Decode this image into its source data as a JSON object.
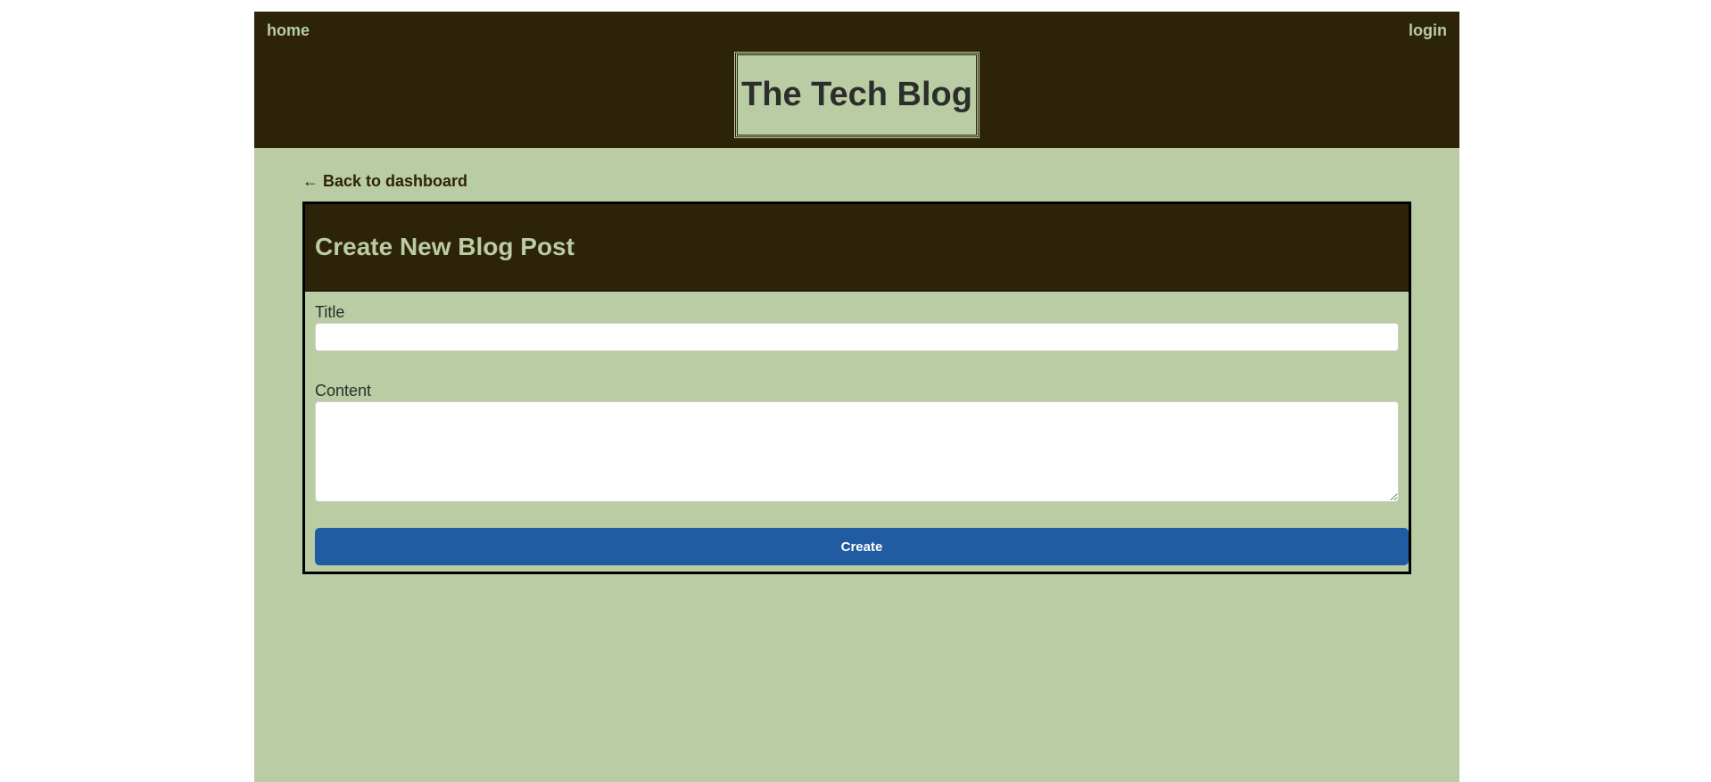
{
  "nav": {
    "home_label": "home",
    "login_label": "login"
  },
  "header": {
    "site_title": "The Tech Blog"
  },
  "main": {
    "back_link": "← Back to dashboard",
    "form": {
      "heading": "Create New Blog Post",
      "title_label": "Title",
      "title_value": "",
      "content_label": "Content",
      "content_value": "",
      "submit_label": "Create"
    }
  },
  "colors": {
    "header_bg": "#2d2309",
    "page_bg": "#b9cca3",
    "button_bg": "#215ca3"
  }
}
